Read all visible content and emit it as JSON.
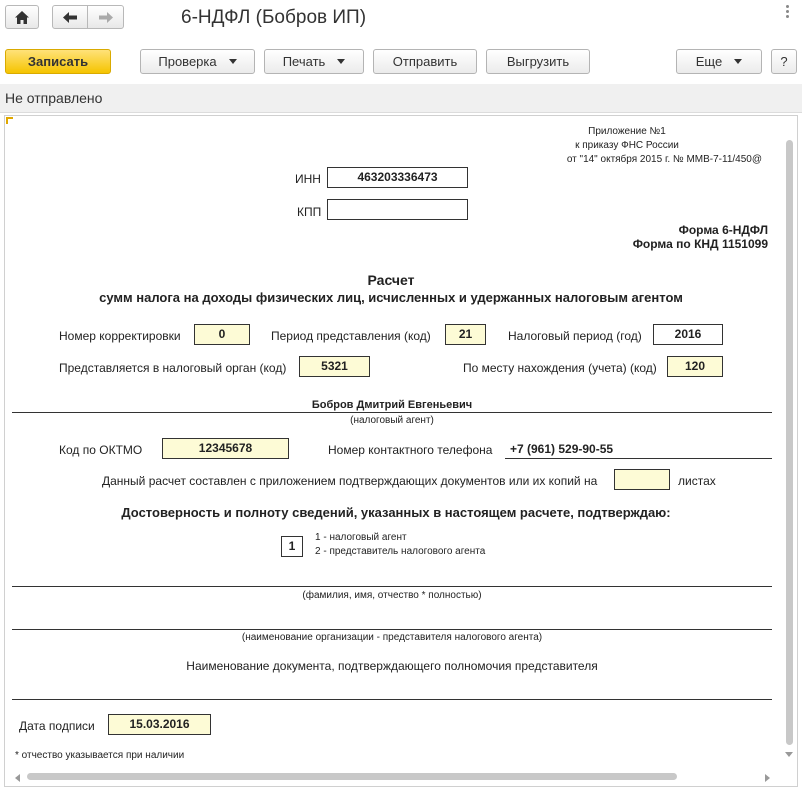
{
  "window": {
    "title": "6-НДФЛ (Бобров ИП)"
  },
  "toolbar": {
    "save_label": "Записать",
    "check_label": "Проверка",
    "print_label": "Печать",
    "send_label": "Отправить",
    "export_label": "Выгрузить",
    "more_label": "Еще",
    "help_label": "?"
  },
  "status": {
    "text": "Не отправлено"
  },
  "form": {
    "appendix_line1": "Приложение №1",
    "appendix_line2": "к приказу ФНС России",
    "appendix_line3": "от \"14\" октября 2015 г. № ММВ-7-11/450@",
    "inn_label": "ИНН",
    "inn_value": "463203336473",
    "kpp_label": "КПП",
    "kpp_value": "",
    "form_name": "Форма 6-НДФЛ",
    "form_knd": "Форма по КНД 1151099",
    "heading": "Расчет",
    "subheading": "сумм налога на доходы физических лиц, исчисленных и удержанных налоговым агентом",
    "correction_label": "Номер корректировки",
    "correction_value": "0",
    "period_code_label": "Период представления (код)",
    "period_code_value": "21",
    "tax_period_label": "Налоговый период (год)",
    "tax_period_value": "2016",
    "tax_authority_label": "Представляется в налоговый орган (код)",
    "tax_authority_value": "5321",
    "location_label": "По месту нахождения (учета) (код)",
    "location_value": "120",
    "agent_name": "Бобров Дмитрий Евгеньевич",
    "agent_caption": "(налоговый агент)",
    "oktmo_label": "Код по ОКТМО",
    "oktmo_value": "12345678",
    "phone_label": "Номер контактного телефона",
    "phone_value": "+7 (961) 529-90-55",
    "attachments_label": "Данный расчет составлен с приложением подтверждающих документов или их копий на",
    "attachments_value": "",
    "attachments_suffix": "листах",
    "confirm_heading": "Достоверность и полноту сведений, указанных в настоящем расчете, подтверждаю:",
    "signer_code": "1",
    "signer_option1": "1 - налоговый агент",
    "signer_option2": "2 - представитель налогового агента",
    "fio_caption": "(фамилия, имя, отчество * полностью)",
    "org_caption": "(наименование организации - представителя налогового агента)",
    "doc_label": "Наименование документа, подтверждающего полномочия представителя",
    "sign_date_label": "Дата подписи",
    "sign_date_value": "15.03.2016",
    "footnote": "* отчество указывается при наличии"
  },
  "colors": {
    "accent_button": "#f5c400",
    "field_highlight": "#fdfbd6",
    "status_background": "#f0f0f0"
  },
  "icons": [
    "home-icon",
    "arrow-left-icon",
    "arrow-right-icon",
    "more-vertical-icon",
    "dropdown-arrow-icon"
  ]
}
